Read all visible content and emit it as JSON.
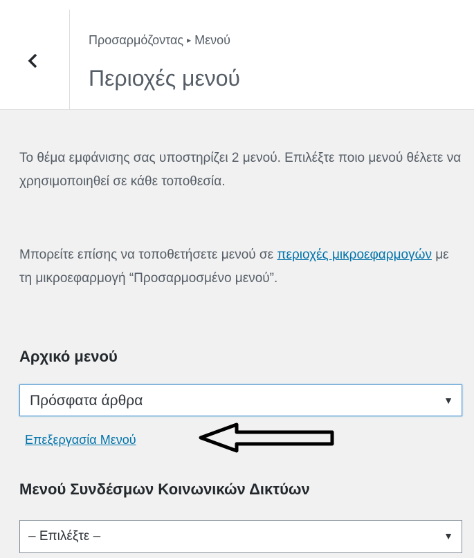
{
  "header": {
    "breadcrumb_part1": "Προσαρμόζοντας",
    "breadcrumb_separator": "▸",
    "breadcrumb_part2": "Μενού",
    "title": "Περιοχές μενού"
  },
  "description": {
    "paragraph1": "Το θέμα εμφάνισης σας υποστηρίζει 2 μενού. Επιλέξτε ποιο μενού θέλετε να χρησιμοποιηθεί σε κάθε τοποθεσία.",
    "paragraph2_prefix": "Μπορείτε επίσης να τοποθετήσετε μενού σε ",
    "paragraph2_link": "περιοχές μικροεφαρμογών",
    "paragraph2_suffix": " με τη μικροεφαρμογή “Προσαρμοσμένο μενού”."
  },
  "primary_menu": {
    "label": "Αρχικό μενού",
    "selected": "Πρόσφατα άρθρα",
    "edit_link": "Επεξεργασία Μενού"
  },
  "social_menu": {
    "label": "Μενού Συνδέσμων Κοινωνικών Δικτύων",
    "selected": "– Επιλέξτε –"
  },
  "icons": {
    "back": "chevron-left-icon",
    "dropdown": "triangle-down-icon",
    "annotation": "arrow-left-annotation"
  },
  "colors": {
    "link": "#0073aa",
    "background": "#f1f1f1",
    "header_bg": "#ffffff",
    "text": "#555d66"
  }
}
